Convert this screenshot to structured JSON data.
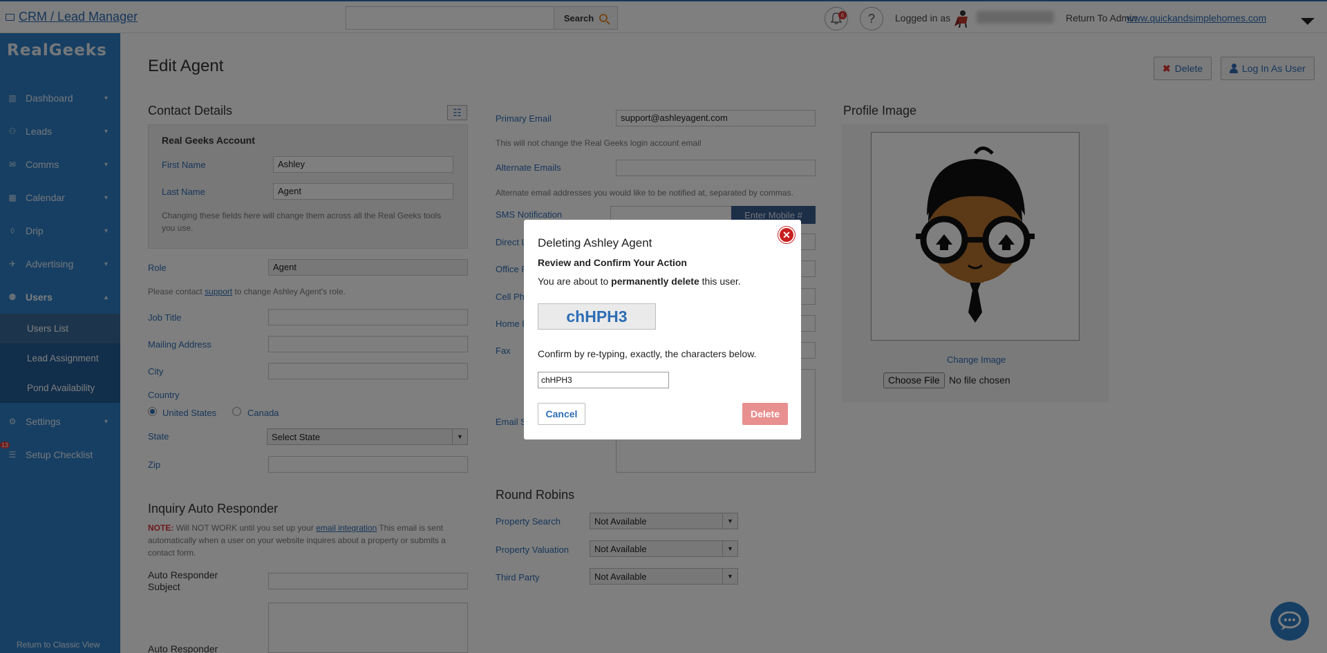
{
  "topbar": {
    "app_title": "CRM / Lead Manager",
    "search_placeholder": "",
    "search_label": "Search",
    "notification_count": "6",
    "help_icon": "?",
    "logged_in_label": "Logged in as",
    "return_admin": "Return To Admin",
    "site_link": "www.quickandsimplehomes.com"
  },
  "sidebar": {
    "logo": "RealGeeks",
    "items": [
      {
        "label": "Dashboard",
        "icon": "chart-icon"
      },
      {
        "label": "Leads",
        "icon": "people-icon"
      },
      {
        "label": "Comms",
        "icon": "envelope-icon"
      },
      {
        "label": "Calendar",
        "icon": "calendar-icon"
      },
      {
        "label": "Drip",
        "icon": "drop-icon"
      },
      {
        "label": "Advertising",
        "icon": "rocket-icon"
      },
      {
        "label": "Users",
        "icon": "users-icon"
      },
      {
        "label": "Settings",
        "icon": "gear-icon"
      },
      {
        "label": "Setup Checklist",
        "icon": "checklist-icon"
      }
    ],
    "sub_items": [
      "Users List",
      "Lead Assignment",
      "Pond Availability"
    ],
    "checklist_badge": "13",
    "classic_view": "Return to Classic View"
  },
  "page": {
    "title": "Edit Agent",
    "delete_btn": "Delete",
    "login_as_btn": "Log In As User"
  },
  "contact": {
    "heading": "Contact Details",
    "account_heading": "Real Geeks Account",
    "first_name_label": "First Name",
    "first_name": "Ashley",
    "last_name_label": "Last Name",
    "last_name": "Agent",
    "account_help": "Changing these fields here will change them across all the Real Geeks tools you use.",
    "role_label": "Role",
    "role_value": "Agent",
    "role_help_pre": "Please contact",
    "role_help_link": "support",
    "role_help_post": "to change Ashley Agent's role.",
    "job_title_label": "Job Title",
    "mailing_label": "Mailing Address",
    "city_label": "City",
    "country_label": "Country",
    "country_us": "United States",
    "country_ca": "Canada",
    "state_label": "State",
    "state_value": "Select State",
    "zip_label": "Zip"
  },
  "responder": {
    "heading": "Inquiry Auto Responder",
    "note_label": "NOTE:",
    "note_pre": "Will NOT WORK until you set up your",
    "note_link": "email integration",
    "note_post": "This email is sent automatically when a user on your website inquires about a property or submits a contact form.",
    "subject_label": "Auto Responder Subject",
    "body_label": "Auto Responder"
  },
  "email": {
    "primary_label": "Primary Email",
    "primary_value": "support@ashleyagent.com",
    "primary_help": "This will not change the Real Geeks login account email",
    "alternate_label": "Alternate Emails",
    "alternate_help": "Alternate email addresses you would like to be notified at, separated by commas.",
    "sms_label": "SMS Notification",
    "enter_mobile": "Enter Mobile #",
    "direct_label": "Direct L",
    "office_label": "Office P",
    "cell_label": "Cell Ph",
    "home_label": "Home P",
    "fax_label": "Fax",
    "email_sig_label": "Email S"
  },
  "round_robins": {
    "heading": "Round Robins",
    "rows": [
      {
        "label": "Property Search",
        "value": "Not Available"
      },
      {
        "label": "Property Valuation",
        "value": "Not Available"
      },
      {
        "label": "Third Party",
        "value": "Not Available"
      }
    ]
  },
  "profile": {
    "heading": "Profile Image",
    "change_image": "Change Image",
    "choose_file": "Choose File",
    "no_file": "No file chosen"
  },
  "modal": {
    "title": "Deleting Ashley Agent",
    "subtitle": "Review and Confirm Your Action",
    "text_pre": "You are about to",
    "text_bold": "permanently delete",
    "text_post": "this user.",
    "captcha": "chHPH3",
    "confirm_text": "Confirm by re-typing, exactly, the characters below.",
    "input_value": "chHPH3",
    "cancel": "Cancel",
    "delete": "Delete"
  },
  "colors": {
    "brand_blue": "#2f7fc7",
    "sidebar_sub": "#225c96",
    "danger": "#c91f1f",
    "delete_btn": "#e88f8f"
  }
}
